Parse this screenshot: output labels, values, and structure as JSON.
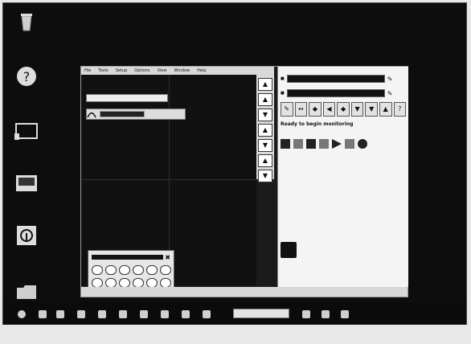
{
  "window": {
    "title": "",
    "menu": [
      "File",
      "Tools",
      "Setup",
      "Options",
      "View",
      "Window",
      "Help"
    ]
  },
  "component_row": {
    "label_left": "",
    "label_right": ""
  },
  "panel": {
    "ready_text": "Ready to begin monitoring",
    "ready_right": "",
    "log_lines": [
      "",
      "",
      "",
      "",
      "",
      "",
      "",
      "",
      "",
      "",
      "",
      "",
      "",
      "",
      ""
    ],
    "about_text": [
      "",
      "",
      "",
      ""
    ],
    "footer": ""
  },
  "statusbar": {
    "items": [
      "",
      "",
      "",
      "",
      ""
    ]
  },
  "desktop": {
    "icons": [
      "recycle-bin-icon",
      "help-icon",
      "monitor-icon",
      "screen-icon",
      "app-logo-icon",
      "folder-icon"
    ]
  },
  "taskbar": {
    "active_label": ""
  },
  "colors": {
    "desktop": "#0d0d0d",
    "window_bg": "#1b1b1b",
    "panel_bg": "#f4f4f4",
    "menubar_bg": "#d8d8d8"
  }
}
